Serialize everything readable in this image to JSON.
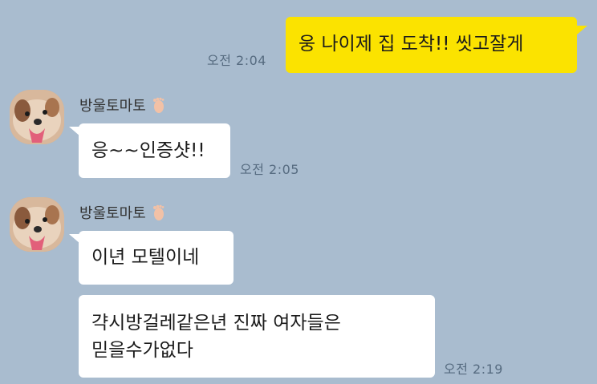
{
  "messages": [
    {
      "side": "mine",
      "text": "웅 나이제 집 도착!! 씻고잘게",
      "time": "오전 2:04"
    },
    {
      "side": "theirs",
      "sender": "방울토마토",
      "text": "응~~인증샷!!",
      "time": "오전 2:05"
    },
    {
      "side": "theirs",
      "sender": "방울토마토",
      "text": "이년 모텔이네"
    },
    {
      "side": "theirs",
      "text_line1": "갹시방걸레같은년 진짜 여자들은",
      "text_line2": "믿을수가없다",
      "time": "오전 2:19"
    }
  ],
  "icons": {
    "avatar": "avatar-dog-photo",
    "sender_badge": "foot-icon"
  },
  "colors": {
    "background": "#a9bccf",
    "my_bubble": "#fbe300",
    "their_bubble": "#ffffff"
  }
}
